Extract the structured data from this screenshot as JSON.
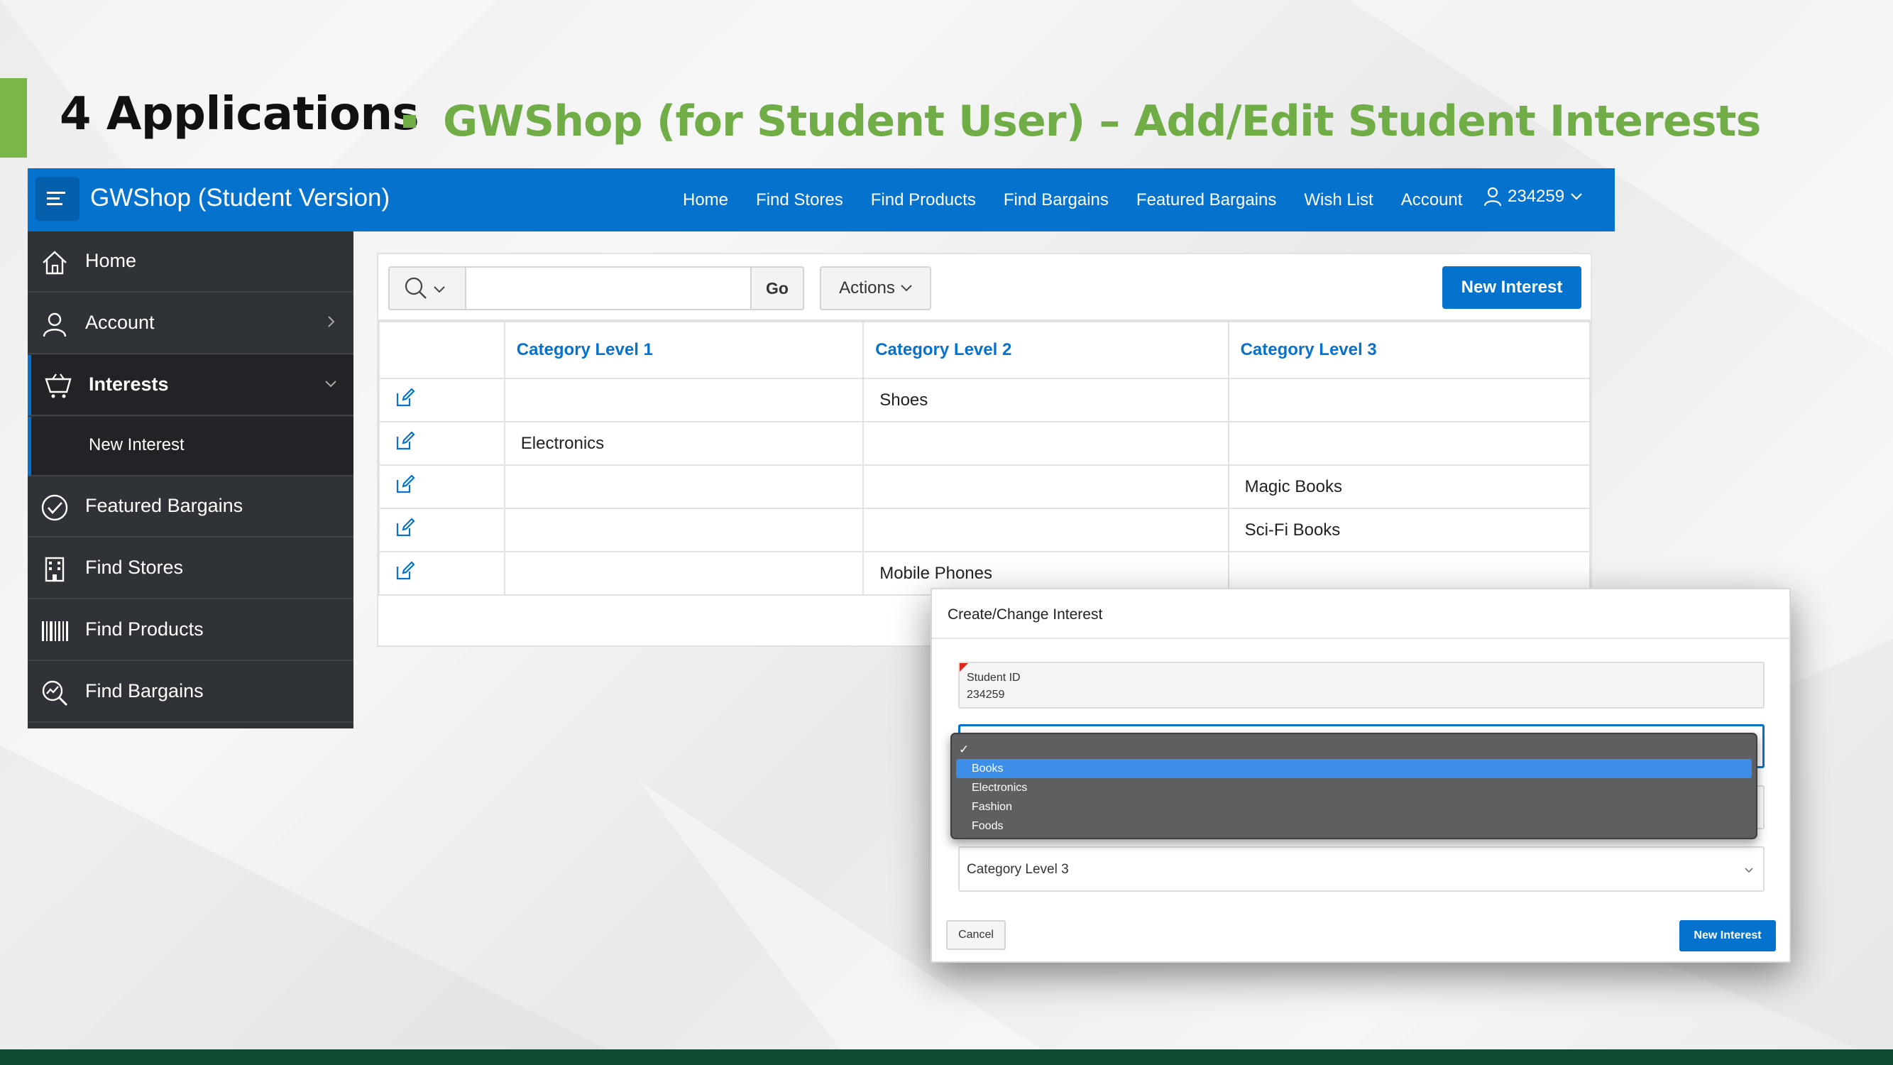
{
  "slide": {
    "title": "4 Applications",
    "subtitle": "GWShop (for Student User) – Add/Edit Student Interests"
  },
  "app": {
    "title": "GWShop (Student Version)",
    "nav": [
      "Home",
      "Find Stores",
      "Find Products",
      "Find Bargains",
      "Featured Bargains",
      "Wish List",
      "Account"
    ],
    "user_id": "234259",
    "accent_color": "#0572ce"
  },
  "sidebar": {
    "items": [
      {
        "label": "Home",
        "icon": "home-icon"
      },
      {
        "label": "Account",
        "icon": "user-icon"
      },
      {
        "label": "Interests",
        "icon": "basket-icon"
      },
      {
        "label": "New Interest",
        "icon": ""
      },
      {
        "label": "Featured Bargains",
        "icon": "check-circle-icon"
      },
      {
        "label": "Find Stores",
        "icon": "building-icon"
      },
      {
        "label": "Find Products",
        "icon": "barcode-icon"
      },
      {
        "label": "Find Bargains",
        "icon": "search-chart-icon"
      }
    ]
  },
  "report": {
    "search_placeholder": "",
    "go_label": "Go",
    "actions_label": "Actions",
    "new_interest_label": "New Interest",
    "columns": [
      "Category Level 1",
      "Category Level 2",
      "Category Level 3"
    ],
    "rows": [
      [
        "",
        "Shoes",
        ""
      ],
      [
        "Electronics",
        "",
        ""
      ],
      [
        "",
        "",
        "Magic Books"
      ],
      [
        "",
        "",
        "Sci-Fi Books"
      ],
      [
        "",
        "Mobile Phones",
        ""
      ]
    ]
  },
  "dialog": {
    "title": "Create/Change Interest",
    "student_id_label": "Student ID",
    "student_id_value": "234259",
    "category3_placeholder": "Category Level 3",
    "cancel_label": "Cancel",
    "submit_label": "New Interest",
    "dropdown_check": "✓",
    "dropdown_options": [
      "Books",
      "Electronics",
      "Fashion",
      "Foods"
    ],
    "dropdown_selected": "Books"
  }
}
